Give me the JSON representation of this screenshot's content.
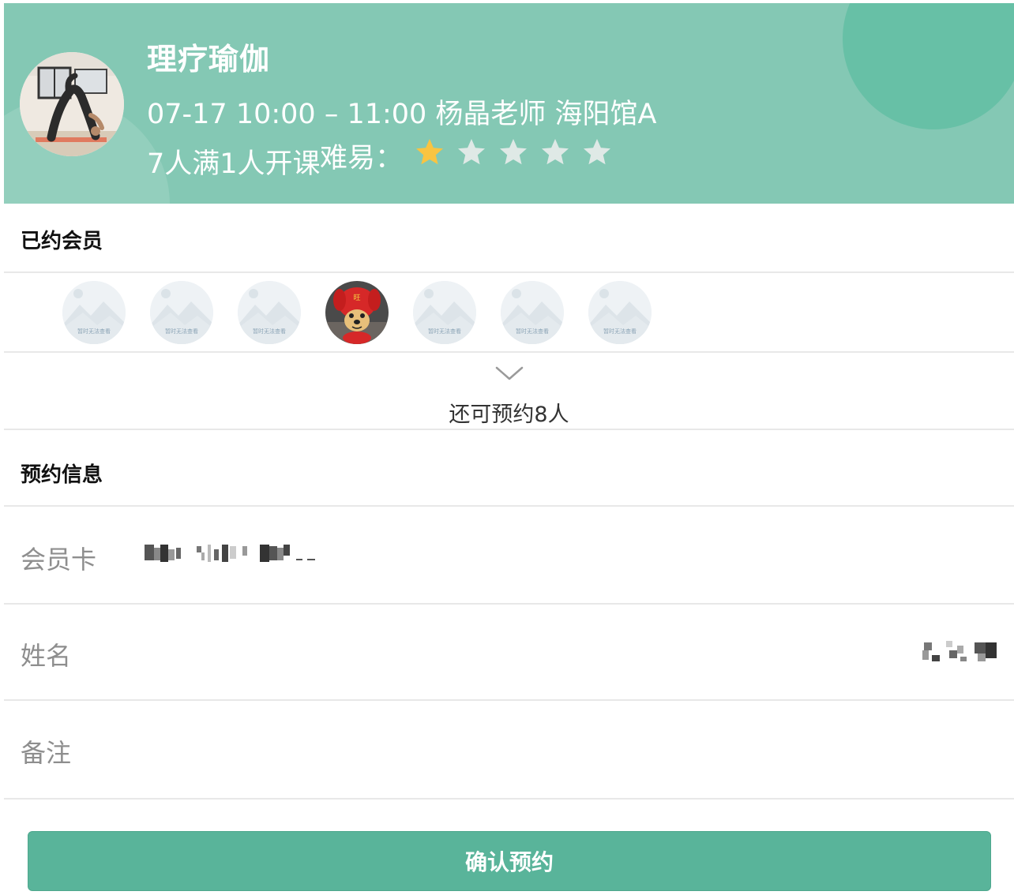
{
  "course": {
    "title": "理疗瑜伽",
    "info": "07-17 10:00 – 11:00 杨晶老师 海阳馆A",
    "capacity": "7人满1人开课",
    "difficulty_label": "难易：",
    "difficulty_rating": 1,
    "difficulty_max": 5
  },
  "booked_section": {
    "title": "已约会员",
    "members": [
      {
        "type": "placeholder",
        "caption": "暂时无法查看"
      },
      {
        "type": "placeholder",
        "caption": "暂时无法查看"
      },
      {
        "type": "placeholder",
        "caption": "暂时无法查看"
      },
      {
        "type": "photo",
        "caption": ""
      },
      {
        "type": "placeholder",
        "caption": "暂时无法查看"
      },
      {
        "type": "placeholder",
        "caption": "暂时无法查看"
      },
      {
        "type": "placeholder",
        "caption": "暂时无法查看"
      }
    ],
    "remaining": "还可预约8人"
  },
  "booking_section": {
    "title": "预约信息",
    "card_label": "会员卡",
    "name_label": "姓名",
    "remark_label": "备注"
  },
  "confirm_label": "确认预约",
  "colors": {
    "header": "#84c8b4",
    "accent": "#59b49a",
    "star_active": "#f9c441",
    "star_inactive": "#dfe9e6"
  },
  "icons": {
    "expand": "chevron-down-icon",
    "star": "star-icon"
  }
}
